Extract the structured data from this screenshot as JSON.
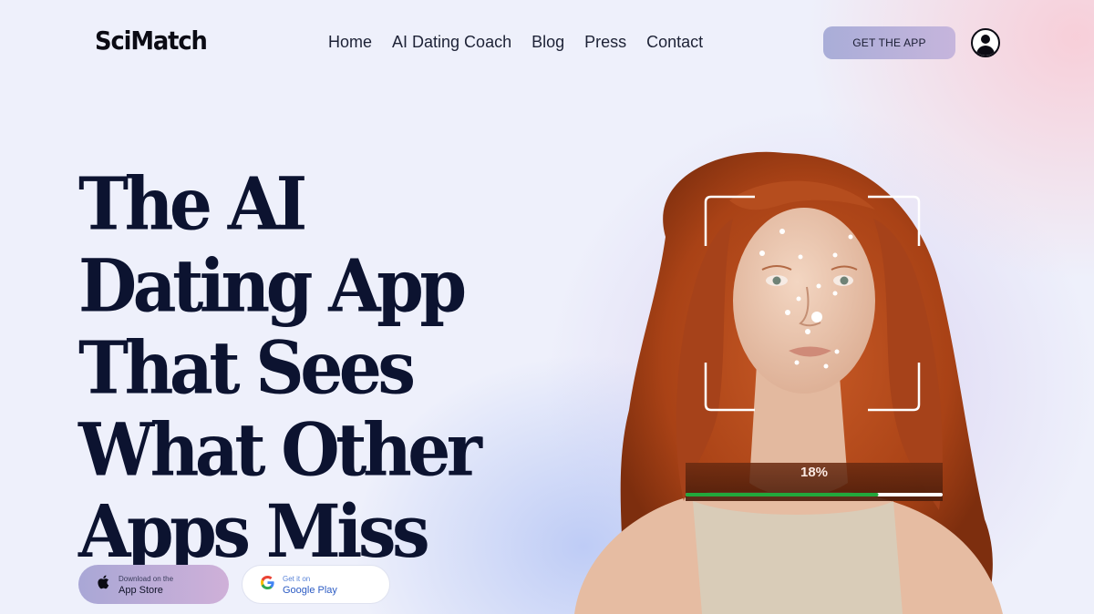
{
  "brand": {
    "logo_text": "SciMatch"
  },
  "nav": {
    "items": [
      {
        "label": "Home"
      },
      {
        "label": "AI Dating Coach"
      },
      {
        "label": "Blog"
      },
      {
        "label": "Press"
      },
      {
        "label": "Contact"
      }
    ],
    "cta_label": "GET THE APP",
    "profile_icon": "user-circle-icon"
  },
  "hero": {
    "headline_lines": [
      "The AI",
      "Dating App",
      "That Sees",
      "What Other",
      "Apps Miss"
    ],
    "app_store": {
      "small": "Download on the",
      "big": "App Store",
      "icon": "apple-icon"
    },
    "google_play": {
      "small": "Get it on",
      "big": "Google Play",
      "icon": "google-icon"
    }
  },
  "scan": {
    "progress_label": "18%",
    "progress_fraction": 0.75,
    "bar_fill_color": "#22a83c",
    "bar_track_color": "#ffffff"
  },
  "colors": {
    "headline": "#0c1330",
    "cta_gradient": [
      "#a9add8",
      "#c6b5dc"
    ],
    "hair": "#b24a1c",
    "skin": "#eecab2"
  }
}
